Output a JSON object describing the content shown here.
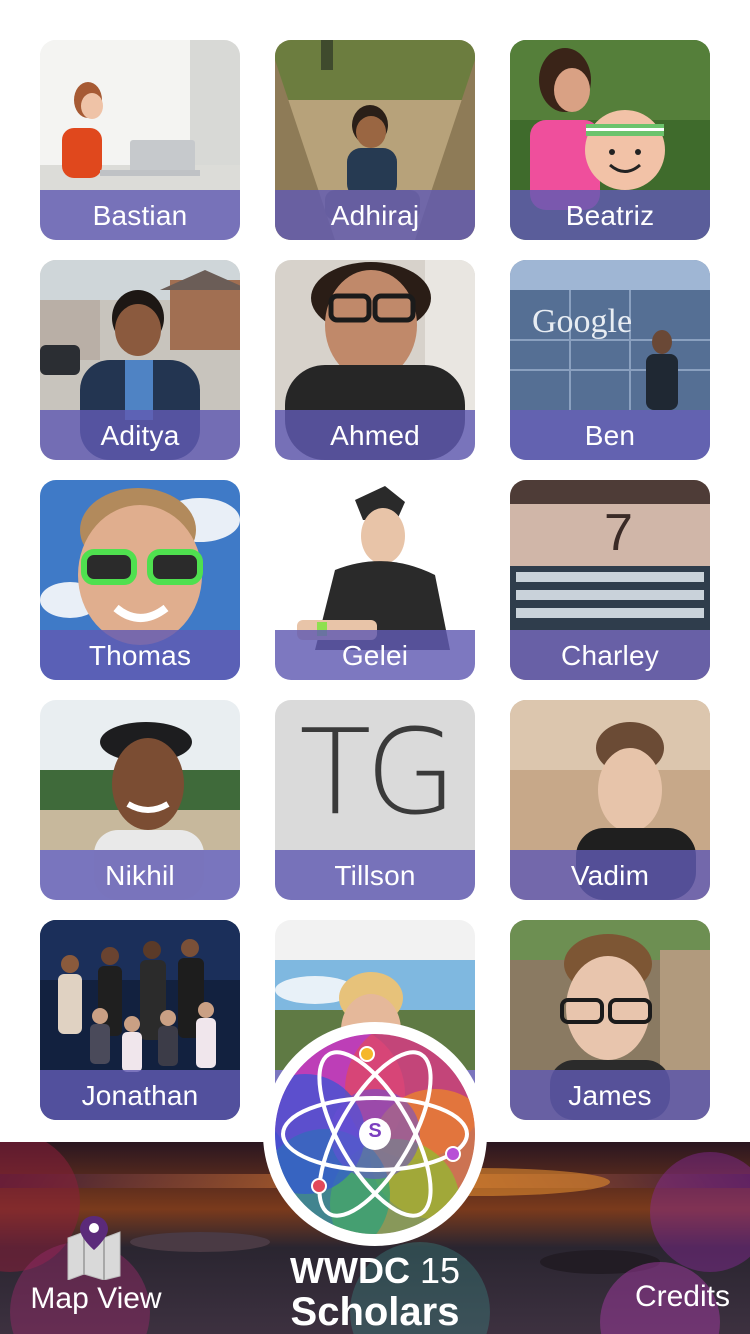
{
  "scholars": [
    {
      "name": "Bastian"
    },
    {
      "name": "Adhiraj"
    },
    {
      "name": "Beatriz"
    },
    {
      "name": "Aditya"
    },
    {
      "name": "Ahmed"
    },
    {
      "name": "Ben"
    },
    {
      "name": "Thomas"
    },
    {
      "name": "Gelei"
    },
    {
      "name": "Charley"
    },
    {
      "name": "Nikhil"
    },
    {
      "name": "Tillson"
    },
    {
      "name": "Vadim"
    },
    {
      "name": "Jonathan"
    },
    {
      "name": ""
    },
    {
      "name": "James"
    }
  ],
  "tiles": {
    "ben_sign": "Google",
    "tillson_initials": "TG",
    "charley_sign": "7"
  },
  "footer": {
    "map_label": "Map View",
    "credits_label": "Credits",
    "title_bold": "WWDC",
    "title_number": "15",
    "subtitle": "Scholars",
    "logo_letter": "S"
  },
  "colors": {
    "name_bar": "#605ab2",
    "accent": "#6b4fd6"
  }
}
